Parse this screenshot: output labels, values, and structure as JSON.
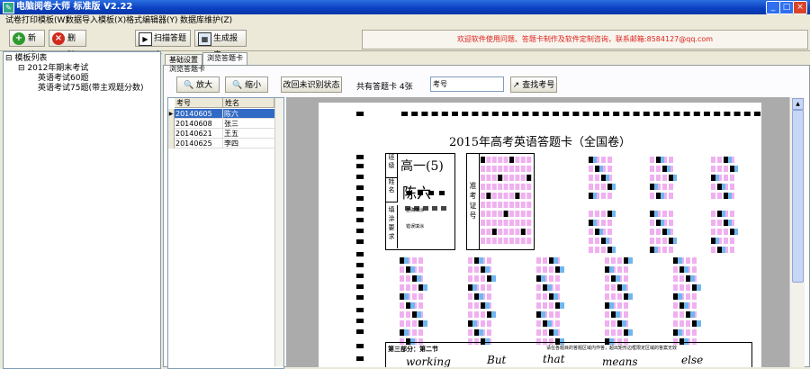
{
  "window": {
    "title": "电脑阅卷大师 标准版 V2.22",
    "minimize": "_",
    "maximize": "□",
    "close": "×"
  },
  "menu": [
    "试卷打印模板(W)",
    "数据导入模板(X)",
    "格式编辑器(Y)",
    "数据库维护(Z)"
  ],
  "toolbar": {
    "new_label": "新建",
    "delete_label": "删除",
    "scan_label": "扫描答题卡",
    "report_label": "生成报表"
  },
  "notice": "欢迎软件使用问题、答题卡制作及软件定制咨询，联系邮箱:8584127@qq.com",
  "tree": {
    "root": "模板列表",
    "exam": "2012年期末考试",
    "items": [
      "英语考试60题",
      "英语考试75题(带主观题分数)"
    ]
  },
  "tabs": [
    "基础设置",
    "浏览答题卡"
  ],
  "group_label": "浏览答题卡",
  "controls": {
    "zoom_in": "放大",
    "zoom_out": "缩小",
    "reset_label": "改回未识别状态",
    "count_text": "共有答题卡 4张",
    "search_field": "考号",
    "find_label": "查找考号"
  },
  "table": {
    "columns": [
      "考号",
      "姓名"
    ],
    "rows": [
      {
        "id": "20140605",
        "name": "陈六"
      },
      {
        "id": "20140608",
        "name": "张三"
      },
      {
        "id": "20140621",
        "name": "王五"
      },
      {
        "id": "20140625",
        "name": "李四"
      }
    ]
  },
  "sheet": {
    "title": "2015年高考英语答题卡（全国卷）",
    "name_labels": [
      "班级",
      "姓名"
    ],
    "class_written": "高一(5)",
    "name_written": "陈六",
    "zkz_label": "准考证号",
    "fill_label": "填涂要求",
    "correct_label": "正确填涂",
    "wrong_label": "错误填涂",
    "section3": "第三部分：第二节",
    "section3_note": "请在各题目的答题区域内作答，超出矩形边框限定区域的答案无效",
    "written_answers": [
      "working",
      "But",
      "that",
      "means",
      "else"
    ]
  },
  "colors": {
    "accent": "#0a3fc0",
    "notice_red": "#e0201c",
    "bubble_pink": "#f0b0f0",
    "bubble_blue": "#6fb7ee"
  }
}
